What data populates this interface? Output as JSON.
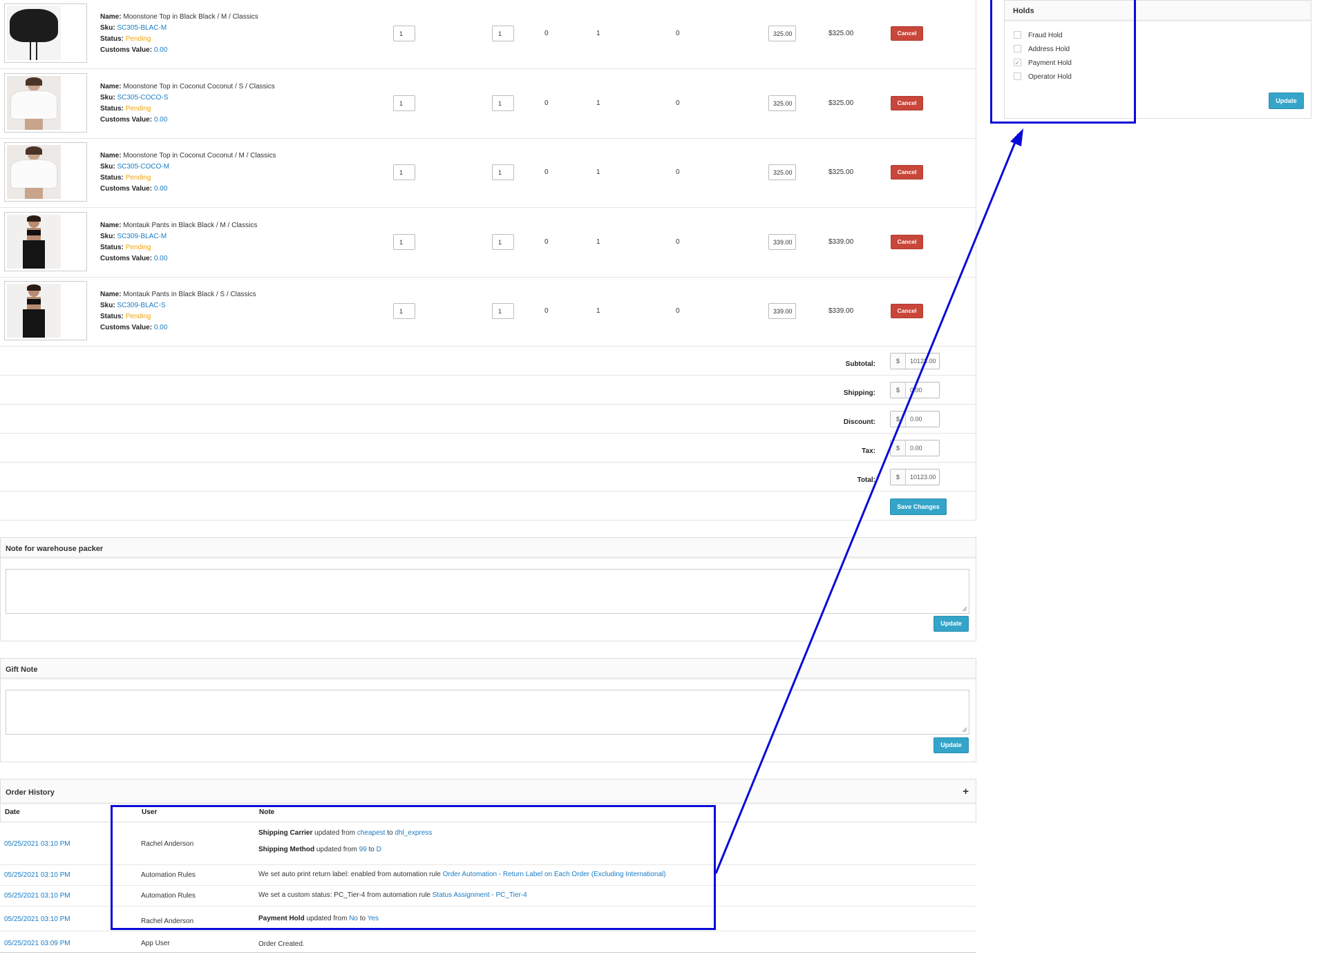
{
  "items": [
    {
      "name": "Moonstone Top in Black Black / M / Classics",
      "sku": "SC305-BLAC-M",
      "status": "Pending",
      "customs_value": "0.00",
      "qty1": "1",
      "qty2": "1",
      "col_a": "0",
      "col_b": "1",
      "col_c": "0",
      "unit_price": "325.00",
      "line_total": "$325.00",
      "image": "black-top"
    },
    {
      "name": "Moonstone Top in Coconut Coconut / S / Classics",
      "sku": "SC305-COCO-S",
      "status": "Pending",
      "customs_value": "0.00",
      "qty1": "1",
      "qty2": "1",
      "col_a": "0",
      "col_b": "1",
      "col_c": "0",
      "unit_price": "325.00",
      "line_total": "$325.00",
      "image": "white-top"
    },
    {
      "name": "Moonstone Top in Coconut Coconut / M / Classics",
      "sku": "SC305-COCO-M",
      "status": "Pending",
      "customs_value": "0.00",
      "qty1": "1",
      "qty2": "1",
      "col_a": "0",
      "col_b": "1",
      "col_c": "0",
      "unit_price": "325.00",
      "line_total": "$325.00",
      "image": "white-top"
    },
    {
      "name": "Montauk Pants in Black Black / M / Classics",
      "sku": "SC309-BLAC-M",
      "status": "Pending",
      "customs_value": "0.00",
      "qty1": "1",
      "qty2": "1",
      "col_a": "0",
      "col_b": "1",
      "col_c": "0",
      "unit_price": "339.00",
      "line_total": "$339.00",
      "image": "black-pants"
    },
    {
      "name": "Montauk Pants in Black Black / S / Classics",
      "sku": "SC309-BLAC-S",
      "status": "Pending",
      "customs_value": "0.00",
      "qty1": "1",
      "qty2": "1",
      "col_a": "0",
      "col_b": "1",
      "col_c": "0",
      "unit_price": "339.00",
      "line_total": "$339.00",
      "image": "black-pants"
    }
  ],
  "labels": {
    "name": "Name:",
    "sku": "Sku:",
    "status": "Status:",
    "customs_value": "Customs Value:",
    "cancel": "Cancel"
  },
  "summary": {
    "currency": "$",
    "subtotal_label": "Subtotal:",
    "subtotal": "10123.00",
    "shipping_label": "Shipping:",
    "shipping": "0.00",
    "discount_label": "Discount:",
    "discount": "0.00",
    "tax_label": "Tax:",
    "tax": "0.00",
    "total_label": "Total:",
    "total": "10123.00",
    "save_label": "Save Changes"
  },
  "warehouse_note": {
    "title": "Note for warehouse packer",
    "value": "",
    "update_label": "Update"
  },
  "gift_note": {
    "title": "Gift Note",
    "value": "",
    "update_label": "Update"
  },
  "history": {
    "title": "Order History",
    "expand_symbol": "+",
    "columns": {
      "date": "Date",
      "user": "User",
      "note": "Note"
    },
    "rows": [
      {
        "date": "05/25/2021 03:10 PM",
        "user": "Rachel Anderson",
        "line1": {
          "field": "Shipping Carrier",
          "text": "updated from",
          "from": "cheapest",
          "to_word": "to",
          "to": "dhl_express"
        },
        "line2": {
          "field": "Shipping Method",
          "text": "updated from",
          "from": "99",
          "to_word": "to",
          "to": "D"
        }
      },
      {
        "date": "05/25/2021 03:10 PM",
        "user": "Automation Rules",
        "text": "We set auto print return label: enabled from automation rule",
        "link": "Order Automation - Return Label on Each Order (Excluding International)"
      },
      {
        "date": "05/25/2021 03:10 PM",
        "user": "Automation Rules",
        "text": "We set a custom status: PC_Tier-4 from automation rule",
        "link": "Status Assignment - PC_Tier-4"
      },
      {
        "date": "05/25/2021 03:10 PM",
        "user": "Rachel Anderson",
        "line1": {
          "field": "Payment Hold",
          "text": "updated from",
          "from": "No",
          "to_word": "to",
          "to": "Yes"
        }
      },
      {
        "date": "05/25/2021 03:09 PM",
        "user": "App User",
        "text": "Order Created."
      }
    ]
  },
  "holds": {
    "title": "Holds",
    "items": [
      {
        "label": "Fraud Hold",
        "checked": false
      },
      {
        "label": "Address Hold",
        "checked": false
      },
      {
        "label": "Payment Hold",
        "checked": true
      },
      {
        "label": "Operator Hold",
        "checked": false
      }
    ],
    "check_mark": "✓",
    "update_label": "Update"
  },
  "colors": {
    "link": "#1a7bc4",
    "pending": "#f0a30a",
    "cancel": "#c9463a",
    "update": "#35a4c9",
    "highlight": "#0a0ad8"
  }
}
